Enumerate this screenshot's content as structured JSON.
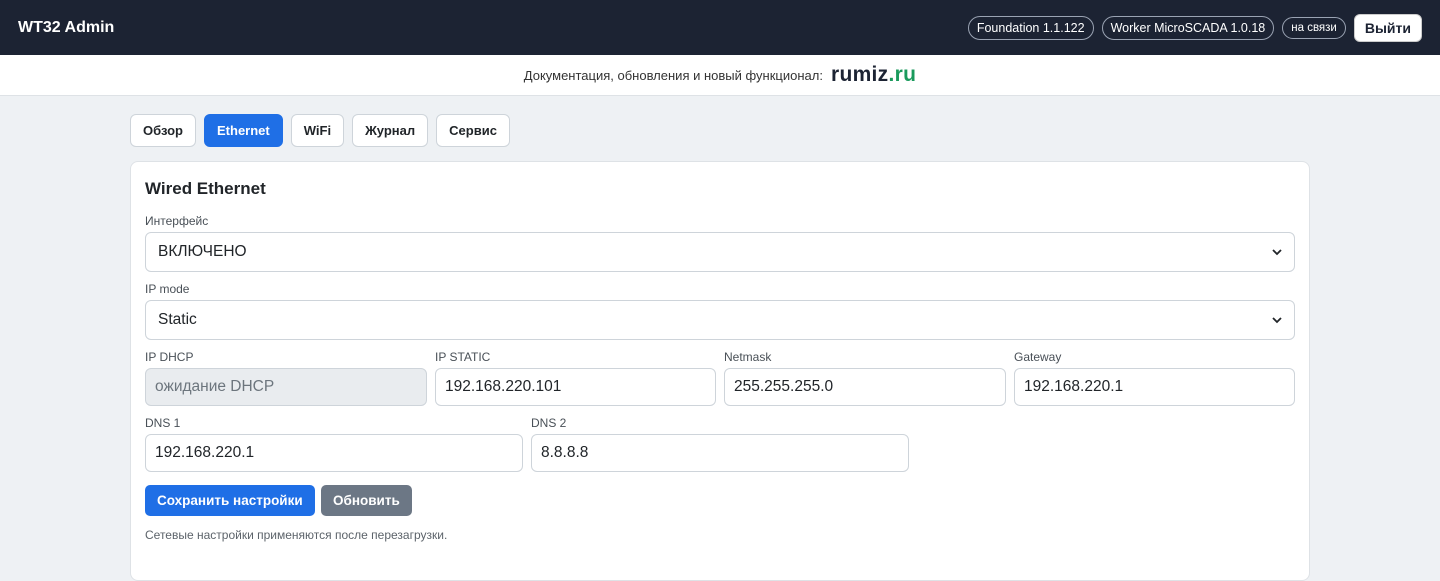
{
  "header": {
    "brand": "WT32 Admin",
    "badges": [
      "Foundation 1.1.122",
      "Worker MicroSCADA 1.0.18",
      "на связи"
    ],
    "logout_label": "Выйти"
  },
  "docbar": {
    "text": "Документация, обновления и новый функционал:",
    "site_part1": "rumiz",
    "site_part2": ".ru"
  },
  "tabs": [
    "Обзор",
    "Ethernet",
    "WiFi",
    "Журнал",
    "Сервис"
  ],
  "active_tab": "Ethernet",
  "card": {
    "title": "Wired Ethernet",
    "interface_label": "Интерфейс",
    "interface_value": "ВКЛЮЧЕНО",
    "ip_mode_label": "IP mode",
    "ip_mode_value": "Static",
    "ip_dhcp_label": "IP DHCP",
    "ip_dhcp_placeholder": "ожидание DHCP",
    "ip_static_label": "IP STATIC",
    "ip_static_value": "192.168.220.101",
    "netmask_label": "Netmask",
    "netmask_value": "255.255.255.0",
    "gateway_label": "Gateway",
    "gateway_value": "192.168.220.1",
    "dns1_label": "DNS 1",
    "dns1_value": "192.168.220.1",
    "dns2_label": "DNS 2",
    "dns2_value": "8.8.8.8",
    "save_label": "Сохранить настройки",
    "refresh_label": "Обновить",
    "note": "Сетевые настройки применяются после перезагрузки."
  },
  "colors": {
    "topbar": "#1c2333",
    "primary": "#1f6fe6",
    "secondary": "#6c7785",
    "brand_green": "#1a9a5c"
  }
}
